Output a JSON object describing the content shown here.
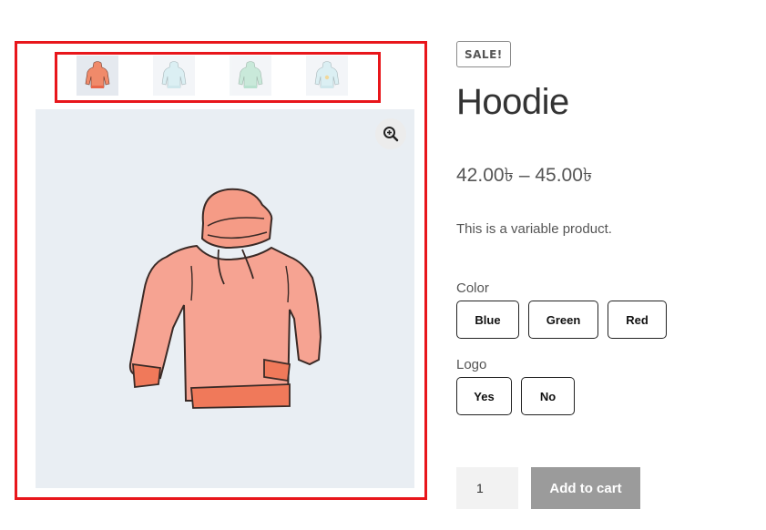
{
  "gallery": {
    "thumbnails": [
      {
        "name": "hoodie-red-thumb",
        "color": "#f08a6a"
      },
      {
        "name": "hoodie-blue-thumb",
        "color": "#c9e6ec"
      },
      {
        "name": "hoodie-green-thumb",
        "color": "#a9dcc4"
      },
      {
        "name": "hoodie-blue-logo-thumb",
        "color": "#c9e6ec"
      }
    ],
    "main_image_color": "#f4a18c",
    "zoom_icon": "zoom-in-icon"
  },
  "product": {
    "sale_badge": "SALE!",
    "title": "Hoodie",
    "price": "42.00৳ – 45.00৳",
    "description": "This is a variable product.",
    "attributes": {
      "color": {
        "label": "Color",
        "options": [
          "Blue",
          "Green",
          "Red"
        ]
      },
      "logo": {
        "label": "Logo",
        "options": [
          "Yes",
          "No"
        ]
      }
    },
    "quantity": "1",
    "add_to_cart_label": "Add to cart"
  },
  "colors": {
    "annotation_red": "#e8161b",
    "button_disabled": "#9b9b9b"
  }
}
